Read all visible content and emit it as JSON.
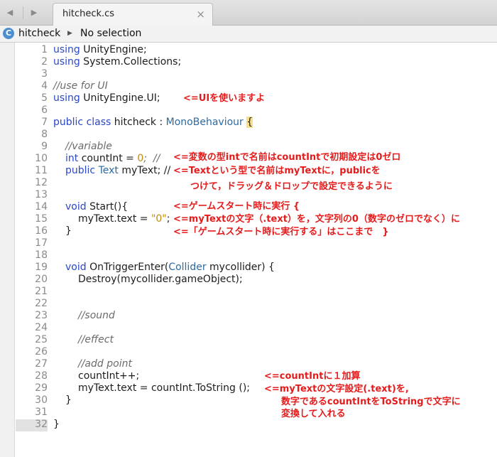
{
  "tab": {
    "title": "hitcheck.cs",
    "close": "×",
    "back": "◀",
    "forward": "▶"
  },
  "breadcrumb": {
    "icon": "C",
    "project": "hitcheck",
    "separator": "▶",
    "selection": "No selection"
  },
  "line_numbers": [
    "1",
    "2",
    "3",
    "4",
    "5",
    "6",
    "7",
    "8",
    "9",
    "10",
    "11",
    "12",
    "13",
    "14",
    "15",
    "16",
    "17",
    "18",
    "19",
    "20",
    "21",
    "22",
    "23",
    "24",
    "25",
    "26",
    "27",
    "28",
    "29",
    "30",
    "31",
    "32"
  ],
  "code": {
    "l1": [
      "using",
      " UnityEngine;"
    ],
    "l2": [
      "using",
      " System.Collections;"
    ],
    "l4": "//use for UI",
    "l5": [
      "using",
      " UnityEngine.UI;"
    ],
    "l7": [
      "public",
      " ",
      "class",
      " hitcheck : ",
      "MonoBehaviour",
      " ",
      "{"
    ],
    "l9": "//variable",
    "l10": [
      "int",
      " countInt = ",
      "0",
      ";  //"
    ],
    "l11": [
      "public",
      " ",
      "Text",
      " myText; //"
    ],
    "l14": [
      "void",
      " Start(){"
    ],
    "l15": [
      "myText.text = ",
      "\"0\"",
      ";"
    ],
    "l16": "}",
    "l19": [
      "void",
      " OnTriggerEnter(",
      "Collider",
      " mycollider) {"
    ],
    "l20": "Destroy(mycollider.gameObject);",
    "l23": "//sound",
    "l25": "//effect",
    "l27": "//add point",
    "l28": "countInt++;",
    "l29": "myText.text = countInt.ToString ();",
    "l30": "}",
    "l32": "}"
  },
  "annotations": {
    "a5": "<=UIを使いますよ",
    "a10": "<=変数の型intで名前はcountIntで初期設定は0ゼロ",
    "a11": "<=Textという型で名前はmyTextに，publicを",
    "a12": "つけて，ドラッグ＆ドロップで設定できるように",
    "a14": "<=ゲームスタート時に実行 {",
    "a15": "<=myTextの文字（.text）を，文字列の0（数字のゼロでなく）に",
    "a16": "<=「ゲームスタート時に実行する」はここまで　}",
    "a28": "<=countIntに１加算",
    "a29": "<=myTextの文字設定(.text)を,",
    "a30": "数字であるcountIntをToStringで文字に",
    "a31": "変換して入れる"
  }
}
